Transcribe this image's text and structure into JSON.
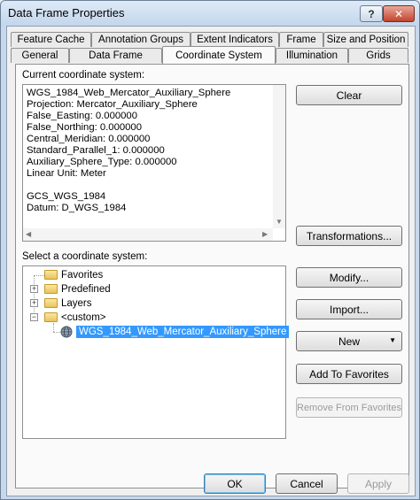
{
  "window": {
    "title": "Data Frame Properties"
  },
  "titlebar": {
    "help_label": "?",
    "close_label": "✕"
  },
  "tabs_row1": [
    "Feature Cache",
    "Annotation Groups",
    "Extent Indicators",
    "Frame",
    "Size and Position"
  ],
  "tabs_row2": [
    "General",
    "Data Frame",
    "Coordinate System",
    "Illumination",
    "Grids"
  ],
  "active_tab": "Coordinate System",
  "current_cs": {
    "label": "Current coordinate system:",
    "text": "WGS_1984_Web_Mercator_Auxiliary_Sphere\nProjection: Mercator_Auxiliary_Sphere\nFalse_Easting: 0.000000\nFalse_Northing: 0.000000\nCentral_Meridian: 0.000000\nStandard_Parallel_1: 0.000000\nAuxiliary_Sphere_Type: 0.000000\nLinear Unit: Meter\n\nGCS_WGS_1984\nDatum: D_WGS_1984"
  },
  "select_cs": {
    "label": "Select a coordinate system:",
    "items": [
      "Favorites",
      "Predefined",
      "Layers",
      "<custom>",
      "WGS_1984_Web_Mercator_Auxiliary_Sphere"
    ]
  },
  "buttons": {
    "clear": "Clear",
    "transformations": "Transformations...",
    "modify": "Modify...",
    "import": "Import...",
    "new": "New",
    "add_to_favorites": "Add To Favorites",
    "remove_from_favorites": "Remove From Favorites"
  },
  "footer": {
    "ok": "OK",
    "cancel": "Cancel",
    "apply": "Apply"
  },
  "colors": {
    "selection": "#3399ff",
    "titlebar": "#c8d8ec",
    "close": "#c4432d"
  }
}
